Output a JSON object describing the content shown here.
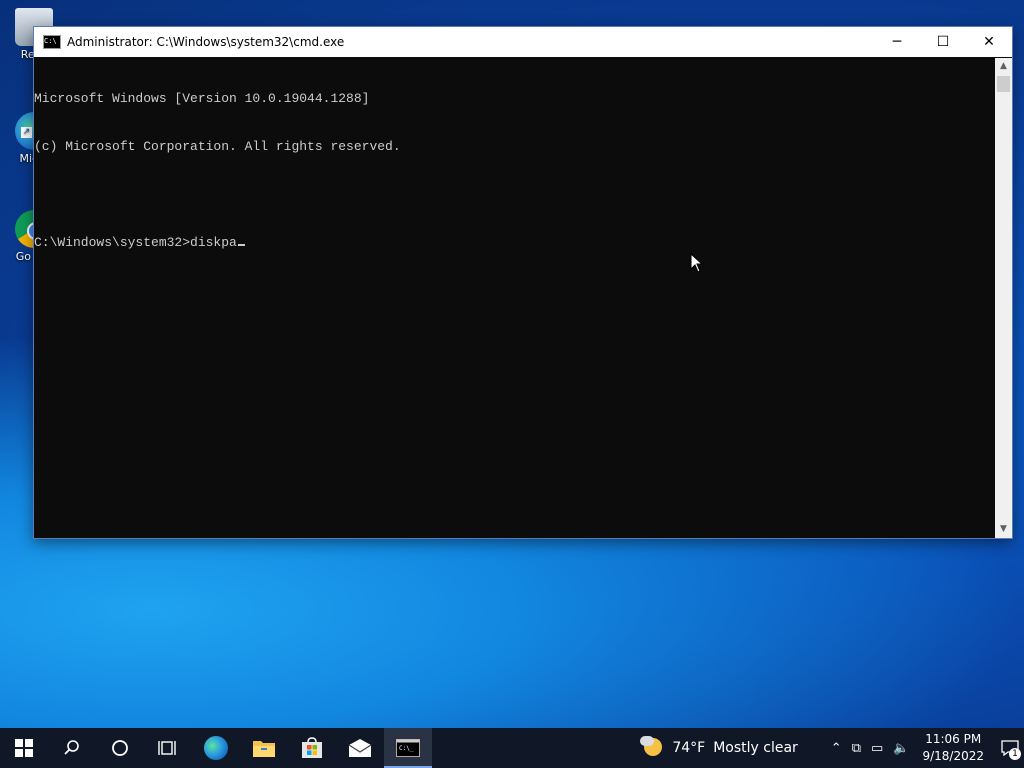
{
  "desktop": {
    "icons": [
      {
        "label": "Recy",
        "name": "recycle-bin"
      },
      {
        "label": "Mic E",
        "name": "microsoft-edge"
      },
      {
        "label": "Go Chi",
        "name": "google-chrome"
      }
    ]
  },
  "window": {
    "title": "Administrator: C:\\Windows\\system32\\cmd.exe",
    "icon_text": "C:\\",
    "buttons": {
      "minimize": "─",
      "maximize": "☐",
      "close": "✕"
    }
  },
  "console": {
    "lines": [
      "Microsoft Windows [Version 10.0.19044.1288]",
      "(c) Microsoft Corporation. All rights reserved.",
      "",
      "C:\\Windows\\system32>diskpa"
    ],
    "text_color": "#cccccc",
    "background": "#0c0c0c"
  },
  "taskbar": {
    "search_icon": "search-icon",
    "cortana_icon": "cortana-icon",
    "taskview_icon": "task-view-icon",
    "apps": [
      "edge-icon",
      "file-explorer-icon",
      "store-icon",
      "mail-icon",
      "cmd-icon"
    ],
    "weather": {
      "temp": "74°F",
      "condition": "Mostly clear"
    },
    "tray": {
      "chevron": "⌃",
      "meet": "⧉",
      "network": "▭",
      "volume": "🔈"
    },
    "clock": {
      "time": "11:06 PM",
      "date": "9/18/2022"
    },
    "notifications": {
      "count": "1"
    }
  }
}
